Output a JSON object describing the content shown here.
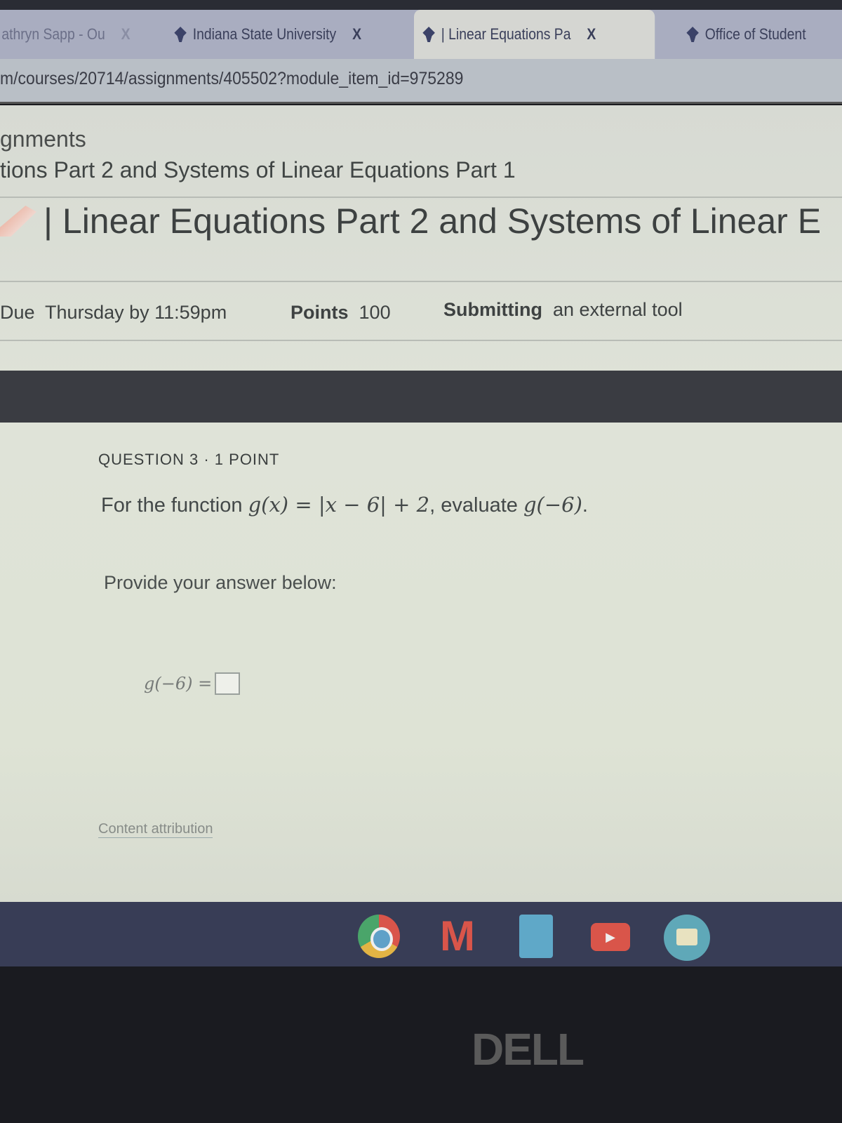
{
  "browser": {
    "tabs": [
      {
        "label": "athryn Sapp - Ou",
        "active": false
      },
      {
        "label": "Indiana State University",
        "active": false
      },
      {
        "label": "| Linear Equations Pa",
        "active": true
      },
      {
        "label": "Office of Student",
        "active": false
      }
    ],
    "close_glyph": "X",
    "address": "m/courses/20714/assignments/405502?module_item_id=975289"
  },
  "breadcrumb": {
    "section": "gnments",
    "module": "tions Part 2 and Systems of Linear Equations Part 1"
  },
  "assignment": {
    "title": "| Linear Equations Part 2 and Systems of Linear E",
    "due_label": "Due",
    "due_value": "Thursday by 11:59pm",
    "points_label": "Points",
    "points_value": "100",
    "submitting_label": "Submitting",
    "submitting_value": "an external tool"
  },
  "question": {
    "header": "QUESTION 3 · 1 POINT",
    "text_prefix": "For the function ",
    "formula": "g(x) = |x − 6| + 2",
    "text_mid": ", evaluate ",
    "target": "g(−6)",
    "text_suffix": ".",
    "prompt": "Provide your answer below:",
    "answer_label": "g(−6) =",
    "answer_value": "",
    "attribution": "Content attribution"
  },
  "shelf": {
    "apps": [
      "chrome-icon",
      "gmail-icon",
      "docs-icon",
      "youtube-icon",
      "files-icon"
    ],
    "gmail_glyph": "M",
    "youtube_glyph": "▶"
  },
  "bezel_logo": "DELL",
  "colors": {
    "banner": "#3a3c42",
    "shelf": "#383d56",
    "tabstrip": "#a9adc0"
  }
}
